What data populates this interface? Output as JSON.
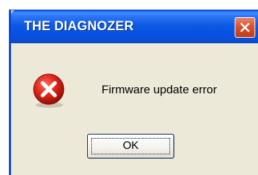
{
  "window": {
    "title": "THE DIAGNOZER",
    "close_icon": "close-icon"
  },
  "dialog": {
    "icon": "error-icon",
    "message": "Firmware update error",
    "ok_label": "OK"
  },
  "colors": {
    "titlebar": "#0a55e0",
    "close_button": "#d8532f",
    "dialog_background": "#ece9d8",
    "error_icon": "#d11a10"
  }
}
